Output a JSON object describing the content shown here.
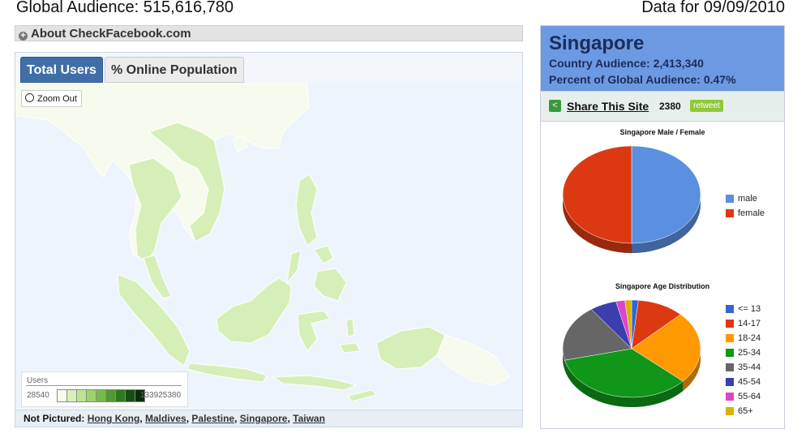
{
  "header": {
    "global_audience": "Global Audience: 515,616,780",
    "data_date": "Data for 09/09/2010"
  },
  "about": {
    "label": "About CheckFacebook.com"
  },
  "map": {
    "tabs": [
      {
        "label": "Total Users"
      },
      {
        "label": "% Online Population"
      }
    ],
    "zoom_label": "Zoom Out",
    "legend": {
      "title": "Users",
      "min": "28540",
      "max": "133925380",
      "colors": [
        "#f4fbe9",
        "#d8f0b8",
        "#bde590",
        "#9bd46b",
        "#74bc4a",
        "#4f9b31",
        "#2e7a1f",
        "#154f12",
        "#082e08"
      ]
    },
    "not_pictured": {
      "label": "Not Pictured:",
      "countries": [
        "Hong Kong",
        "Maldives",
        "Palestine",
        "Singapore",
        "Taiwan"
      ]
    },
    "colors": {
      "sea": "#eef4fb",
      "land_light": "#f7fbee",
      "land_mid": "#d6efb8",
      "land_dark": "#a9dc84",
      "border": "#ffffff"
    }
  },
  "sidebar": {
    "country": "Singapore",
    "audience": "Country Audience: 2,413,340",
    "percent": "Percent of Global Audience: 0.47%",
    "share_label": "Share This Site",
    "share_count": "2380",
    "retweet_label": "retweet",
    "header_color": "#6b9ae3"
  },
  "chart_data": [
    {
      "type": "pie",
      "title": "Singapore Male / Female",
      "categories": [
        "male",
        "female"
      ],
      "values": [
        50,
        50
      ],
      "colors": [
        "#5b8fe0",
        "#dc3912"
      ],
      "legend": "right"
    },
    {
      "type": "pie",
      "title": "Singapore Age Distribution",
      "categories": [
        "<= 13",
        "14-17",
        "18-24",
        "25-34",
        "35-44",
        "45-54",
        "55-64",
        "65+"
      ],
      "values": [
        1.5,
        10.5,
        23,
        33,
        18,
        6,
        2,
        1.5
      ],
      "colors": [
        "#3366cc",
        "#dc3912",
        "#ff9900",
        "#109618",
        "#666666",
        "#3b3eac",
        "#dd44cc",
        "#d8b300"
      ],
      "legend": "right"
    }
  ]
}
